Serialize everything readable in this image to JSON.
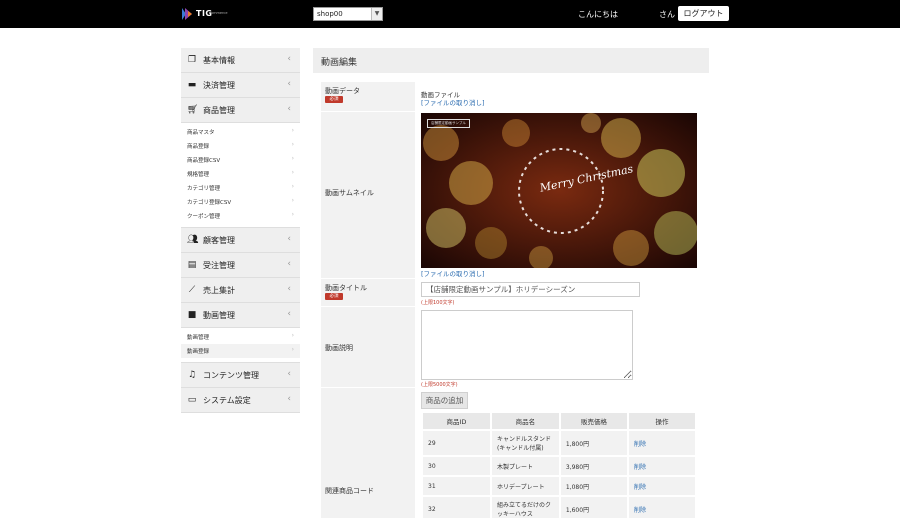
{
  "header": {
    "logo_text": "TIG",
    "logo_sub": "commerce",
    "shop_select_value": "shop00",
    "greeting": "こんにちは",
    "san": "さん",
    "logout_label": "ログアウト"
  },
  "sidebar": {
    "items": [
      {
        "label": "基本情報",
        "icon": "copy-icon"
      },
      {
        "label": "決済管理",
        "icon": "card-icon"
      },
      {
        "label": "商品管理",
        "icon": "cart-icon"
      },
      {
        "label": "顧客管理",
        "icon": "users-icon"
      },
      {
        "label": "受注管理",
        "icon": "document-icon"
      },
      {
        "label": "売上集計",
        "icon": "chart-icon"
      },
      {
        "label": "動画管理",
        "icon": "video-icon"
      },
      {
        "label": "コンテンツ管理",
        "icon": "music-icon"
      },
      {
        "label": "システム設定",
        "icon": "monitor-icon"
      }
    ],
    "product_sub": [
      "商品マスタ",
      "商品登録",
      "商品登録CSV",
      "規格管理",
      "カテゴリ管理",
      "カテゴリ登録CSV",
      "クーポン管理"
    ],
    "video_sub": [
      "動画管理",
      "動画登録"
    ]
  },
  "main": {
    "page_title": "動画編集",
    "required_badge": "必須",
    "labels": {
      "video_data": "動画データ",
      "thumbnail": "動画サムネイル",
      "title": "動画タイトル",
      "description": "動画説明",
      "related": "関連商品コード"
    },
    "video_file_label": "動画ファイル",
    "cancel_file_link": "[ファイルの取り消し]",
    "thumb_badge": "店舗限定動画サンプル",
    "thumb_text": "Merry Christmas",
    "title_value": "【店舗限定動画サンプル】ホリデーシーズン",
    "title_hint": "(上限100文字)",
    "desc_value": "",
    "desc_hint": "(上限5000文字)",
    "add_product_label": "商品の追加",
    "table": {
      "headers": [
        "商品ID",
        "商品名",
        "販売価格",
        "操作"
      ],
      "rows": [
        {
          "id": "29",
          "name": "キャンドルスタンド(キャンドル付属)",
          "price": "1,800円",
          "action": "削除"
        },
        {
          "id": "30",
          "name": "木製プレート",
          "price": "3,980円",
          "action": "削除"
        },
        {
          "id": "31",
          "name": "ホリデープレート",
          "price": "1,080円",
          "action": "削除"
        },
        {
          "id": "32",
          "name": "組み立てるだけのクッキーハウス",
          "price": "1,600円",
          "action": "削除"
        }
      ]
    }
  }
}
